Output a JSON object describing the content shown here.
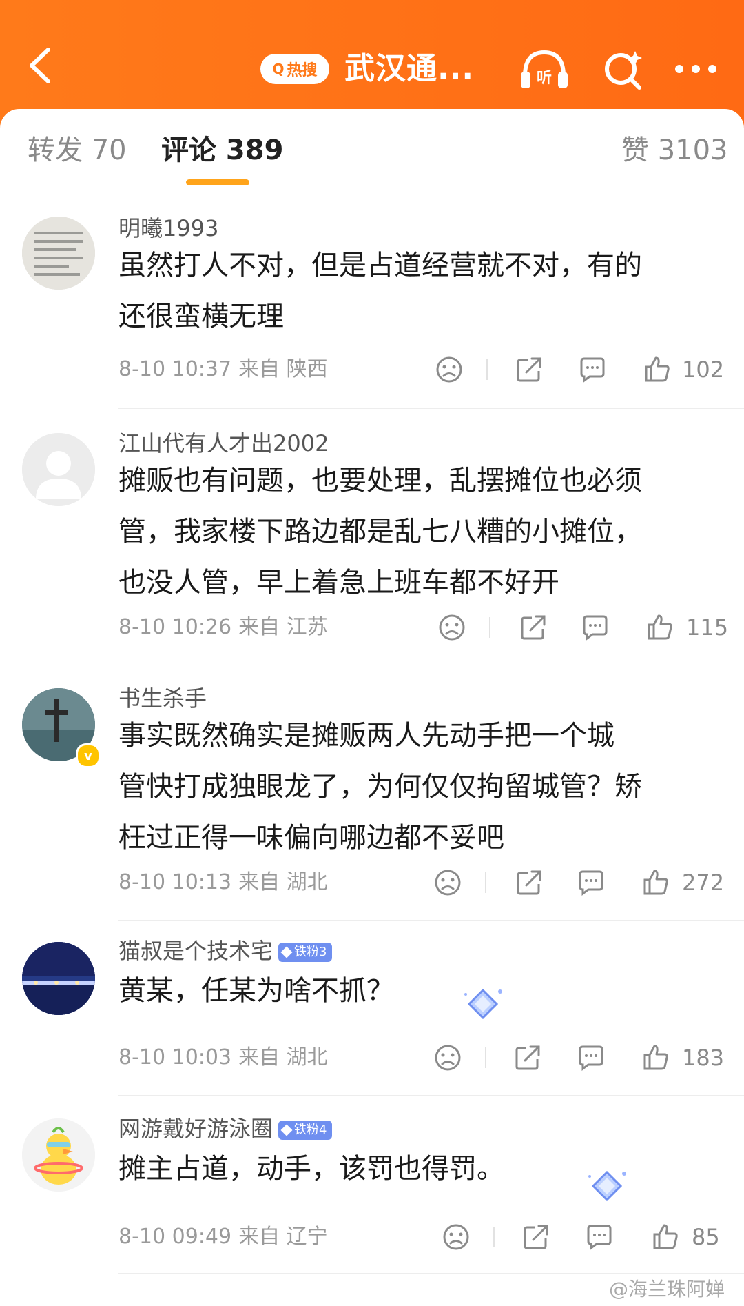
{
  "header": {
    "title": "武汉通...",
    "hot_label": "热搜",
    "brand_color": "#ff7a1a"
  },
  "tabs": {
    "forward": "转发 70",
    "comments": "评论 389",
    "likes": "赞 3103",
    "underline_color": "#ffa41b"
  },
  "comments": [
    {
      "username": "明曦1993",
      "badge": "",
      "text_lines": [
        "虽然打人不对，但是占道经营就不对，有的",
        "还很蛮横无理"
      ],
      "date": "8-10 10:37",
      "from": "来自 陕西",
      "likes": "102"
    },
    {
      "username": "江山代有人才出2002",
      "badge": "",
      "text_lines": [
        "摊贩也有问题，也要处理，乱摆摊位也必须",
        "管，我家楼下路边都是乱七八糟的小摊位，",
        "也没人管，早上着急上班车都不好开"
      ],
      "date": "8-10 10:26",
      "from": "来自 江苏",
      "likes": "115"
    },
    {
      "username": "书生杀手",
      "badge": "",
      "text_lines": [
        "事实既然确实是摊贩两人先动手把一个城",
        "管快打成独眼龙了，为何仅仅拘留城管？矫",
        "枉过正得一味偏向哪边都不妥吧"
      ],
      "date": "8-10 10:13",
      "from": "来自 湖北",
      "likes": "272"
    },
    {
      "username": "猫叔是个技术宅",
      "badge": "铁粉3",
      "text_lines": [
        "黄某，任某为啥不抓？"
      ],
      "date": "8-10 10:03",
      "from": "来自 湖北",
      "likes": "183"
    },
    {
      "username": "网游戴好游泳圈",
      "badge": "铁粉4",
      "text_lines": [
        "摊主占道，动手，该罚也得罚。"
      ],
      "date": "8-10 09:49",
      "from": "来自 辽宁",
      "likes": "85"
    }
  ],
  "watermark": "@海兰珠阿婵",
  "icons": {
    "back": "chevron-left-icon",
    "listen": "headphones-icon",
    "search": "search-sparkle-icon",
    "more": "more-dots-icon",
    "dislike": "frown-face-icon",
    "share": "share-icon",
    "reply": "comment-bubble-icon",
    "like": "thumbs-up-icon"
  }
}
